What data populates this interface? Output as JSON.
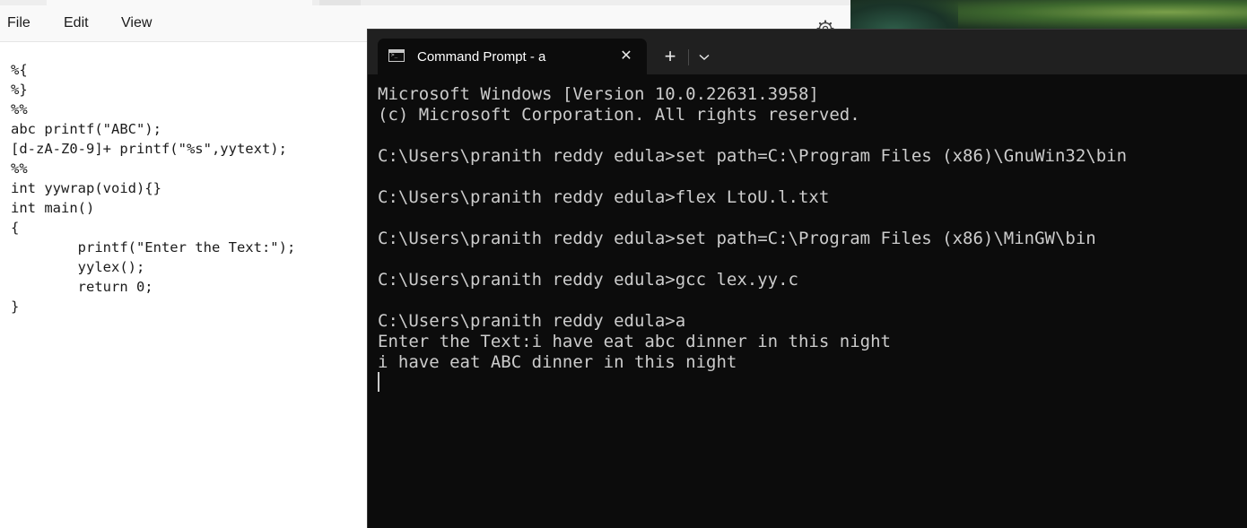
{
  "notepad": {
    "menu": [
      "File",
      "Edit",
      "View"
    ],
    "settings_icon": "gear-icon",
    "code": "%{\n%}\n%%\nabc printf(\"ABC\");\n[d-zA-Z0-9]+ printf(\"%s\",yytext);\n%%\nint yywrap(void){}\nint main()\n{\n\tprintf(\"Enter the Text:\");\n\tyylex();\n\treturn 0;\n}"
  },
  "terminal": {
    "tab_title": "Command Prompt - a",
    "tab_icon": "terminal-icon",
    "close_glyph": "✕",
    "newtab_glyph": "+",
    "dropdown_glyph": "⌄",
    "output": "Microsoft Windows [Version 10.0.22631.3958]\n(c) Microsoft Corporation. All rights reserved.\n\nC:\\Users\\pranith reddy edula>set path=C:\\Program Files (x86)\\GnuWin32\\bin\n\nC:\\Users\\pranith reddy edula>flex LtoU.l.txt\n\nC:\\Users\\pranith reddy edula>set path=C:\\Program Files (x86)\\MinGW\\bin\n\nC:\\Users\\pranith reddy edula>gcc lex.yy.c\n\nC:\\Users\\pranith reddy edula>a\nEnter the Text:i have eat abc dinner in this night\ni have eat ABC dinner in this night"
  }
}
